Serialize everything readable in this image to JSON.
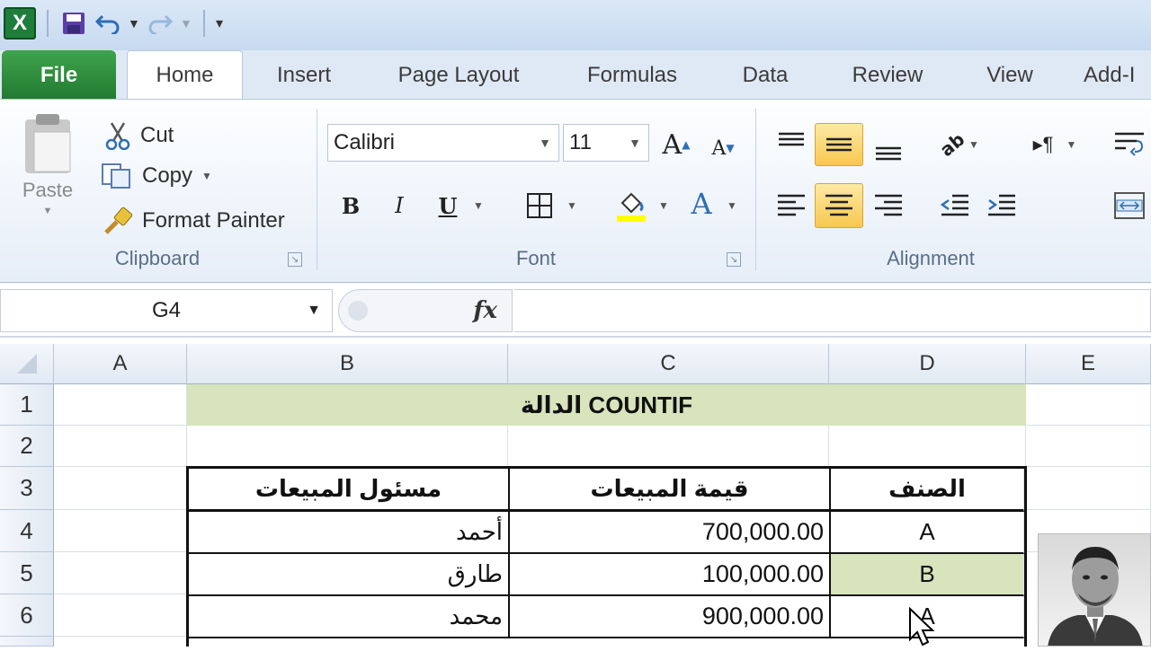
{
  "qat": {
    "app_icon": "excel-icon",
    "items": [
      "save-icon",
      "undo-icon",
      "redo-icon",
      "customize-icon"
    ],
    "app_icon_letter": "X"
  },
  "tabs": [
    "File",
    "Home",
    "Insert",
    "Page Layout",
    "Formulas",
    "Data",
    "Review",
    "View",
    "Add-I"
  ],
  "clipboard": {
    "paste": "Paste",
    "cut": "Cut",
    "copy": "Copy",
    "format_painter": "Format Painter",
    "label": "Clipboard"
  },
  "font": {
    "name": "Calibri",
    "size": "11",
    "label": "Font",
    "bold": "B",
    "italic": "I",
    "underline": "U",
    "grow": "A",
    "shrink": "A",
    "color_letter": "A"
  },
  "alignment": {
    "label": "Alignment"
  },
  "formula_bar": {
    "name_box": "G4",
    "fx": "fx",
    "formula": ""
  },
  "columns": [
    "A",
    "B",
    "C",
    "D",
    "E"
  ],
  "rows": [
    "1",
    "2",
    "3",
    "4",
    "5",
    "6"
  ],
  "sheet": {
    "title": "الدالة COUNTIF",
    "headers": {
      "b": "مسئول المبيعات",
      "c": "قيمة المبيعات",
      "d": "الصنف"
    },
    "data": [
      {
        "name": "أحمد",
        "value": "700,000.00",
        "cat": "A"
      },
      {
        "name": "طارق",
        "value": "100,000.00",
        "cat": "B"
      },
      {
        "name": "محمد",
        "value": "900,000.00",
        "cat": "A"
      }
    ]
  },
  "colors": {
    "accent": "#217a30",
    "title_fill": "#d7e4bc",
    "highlight": "#f7c84e"
  }
}
